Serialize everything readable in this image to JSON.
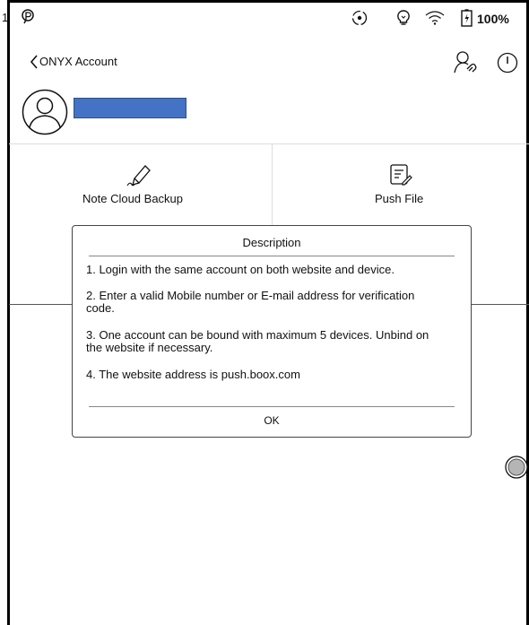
{
  "status": {
    "left_number": "1",
    "battery": "100%",
    "icons": [
      "p-icon",
      "sync-icon",
      "lightbulb-icon",
      "wifi-icon",
      "battery-icon"
    ]
  },
  "header": {
    "title": "ONYX Account",
    "icons": [
      "back-icon",
      "unbind-icon",
      "power-icon"
    ]
  },
  "profile": {
    "avatar_icon": "person-icon",
    "name_color": "#4472c4"
  },
  "features": {
    "backup": {
      "label": "Note Cloud Backup",
      "icon": "pen-icon"
    },
    "push": {
      "label": "Push File",
      "icon": "document-edit-icon"
    }
  },
  "dialog": {
    "title": "Description",
    "items": [
      "1. Login with the same account on both website and device.",
      "2. Enter a valid Mobile number or E-mail address for verification code.",
      "3. One account can be bound with maximum 5 devices. Unbind on the website if necessary.",
      "4. The website address is push.boox.com"
    ],
    "ok": "OK"
  }
}
